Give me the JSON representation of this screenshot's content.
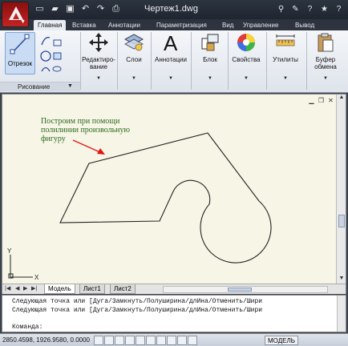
{
  "title_bar": {
    "document_title": "Чертеж1.dwg",
    "qat_icons": [
      "new-icon",
      "open-icon",
      "save-icon",
      "undo-icon",
      "redo-icon",
      "print-icon"
    ],
    "right_icons": [
      "binoculars-icon",
      "tools-icon",
      "help-icon",
      "star-icon",
      "help-icon"
    ]
  },
  "tabs": [
    "Главная",
    "Вставка",
    "Аннотации",
    "Параметризация",
    "Вид",
    "Управление",
    "Вывод"
  ],
  "ribbon": {
    "draw_big": "Отрезок",
    "draw_panel": "Рисование",
    "edit": "Редактиро-\nвание",
    "layers": "Слои",
    "annotations": "Аннотации",
    "block": "Блок",
    "properties": "Свойства",
    "utilities": "Утилиты",
    "clipboard": "Буфер\nобмена"
  },
  "drawing": {
    "annotation": "Построим при помощи\nполилинии произвольную\nфигуру",
    "ucs_y": "Y",
    "ucs_x": "X"
  },
  "layout_tabs": [
    "Модель",
    "Лист1",
    "Лист2"
  ],
  "command_line": {
    "line1": "Следующая точка или [Дуга/Замкнуть/Полуширина/длИна/Отменить/Шири",
    "line2": "Следующая точка или [Дуга/Замкнуть/Полуширина/длИна/Отменить/Шири",
    "prompt": "Команда:"
  },
  "status_bar": {
    "coordinates": "2850.4598, 1926.9580, 0.0000",
    "model": "МОДЕЛЬ"
  }
}
